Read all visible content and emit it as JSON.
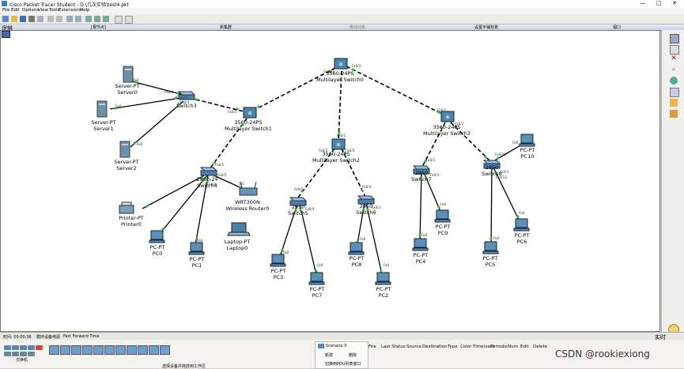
{
  "window": {
    "title": "Cisco Packet Tracer Student - D:\\几次实验\\test4.pkt",
    "min": "—",
    "max": "□",
    "close": "✕"
  },
  "menu": [
    "File",
    "Edit",
    "Options",
    "View",
    "Tools",
    "Extensions",
    "Help"
  ],
  "workspace_bar": {
    "logical": "逻辑",
    "root": "[根节点]",
    "new_cluster": "新集群",
    "move_object": "移动对象",
    "set_tiled_background": "设置平铺背景",
    "viewport": "视口"
  },
  "devices": [
    {
      "name": "Server-PT",
      "name2": "Server0"
    },
    {
      "name": "Server-PT",
      "name2": "Server1"
    },
    {
      "name": "Server-PT",
      "name2": "Server2"
    },
    {
      "name": "Switch3",
      "name2": ""
    },
    {
      "name": "3560-24PS",
      "name2": "Multilayer Switch1"
    },
    {
      "name": "3560-24PS",
      "name2": "Multilayer Switch0"
    },
    {
      "name": "3560-24PS",
      "name2": "Multilayer Switch2"
    },
    {
      "name": "3560-24PS",
      "name2": "Multilayer Switch3"
    },
    {
      "name": "2960-24",
      "name2": "Switch4"
    },
    {
      "name": "WRT300N",
      "name2": "Wireless Router0"
    },
    {
      "name": "Printer-PT",
      "name2": "Printer0"
    },
    {
      "name": "PC-PT",
      "name2": "PC0"
    },
    {
      "name": "PC-PT",
      "name2": "PC1"
    },
    {
      "name": "Laptop-PT",
      "name2": "Laptop0"
    },
    {
      "name": "2950",
      "name2": "Switch5"
    },
    {
      "name": "2950",
      "name2": "Switch6"
    },
    {
      "name": "PC-PT",
      "name2": "PC3"
    },
    {
      "name": "PC-PT",
      "name2": "PC7"
    },
    {
      "name": "PC-PT",
      "name2": "PC8"
    },
    {
      "name": "PC-PT",
      "name2": "PC2"
    },
    {
      "name": "2950",
      "name2": "Switch7"
    },
    {
      "name": "2950",
      "name2": "Switch8"
    },
    {
      "name": "PC-PT",
      "name2": "PC4"
    },
    {
      "name": "PC-PT",
      "name2": "PC9"
    },
    {
      "name": "PC-PT",
      "name2": "PC5"
    },
    {
      "name": "PC-PT",
      "name2": "PC6"
    },
    {
      "name": "PC-PT",
      "name2": "PC10"
    }
  ],
  "ports": [
    "Fa0",
    "Fa0/1",
    "Fa0/2",
    "Fa0/3",
    "Fa0/4",
    "Fa0/5",
    "Fa0/24",
    "Gig0/1",
    "Fa0/23",
    "0/0",
    "Fa0/22"
  ],
  "status": {
    "time_label": "时间: 00:00:36",
    "power_cycle": "循环设备电源",
    "fast_forward": "Fast Forward Time",
    "realtime": "实时"
  },
  "bottom": {
    "category_label": "交换机",
    "device_hint": "选择设备并拖放到工作区",
    "scenario": "Scenario 0",
    "new": "新建",
    "delete": "删除",
    "toggle_pdu": "切换到PDU列表窗口"
  },
  "pdu_columns": [
    "Fire",
    "Last Status",
    "Source",
    "Destination",
    "Type",
    "Color",
    "Time(sec)",
    "Periodic",
    "Num",
    "Edit",
    "Delete"
  ],
  "watermark": "CSDN @rookiexiong"
}
